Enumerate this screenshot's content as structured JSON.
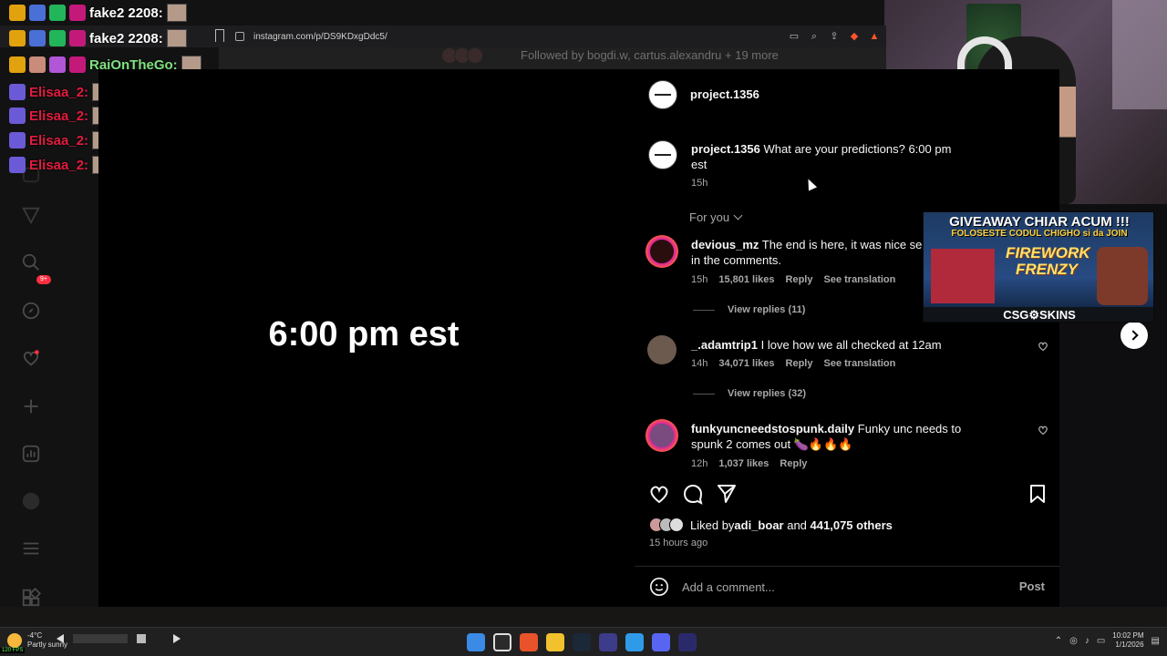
{
  "browser": {
    "url": "instagram.com/p/DS9KDxgDdc5/"
  },
  "chat_overlay": {
    "lines": [
      {
        "name": "fake2",
        "suffix": "2208:"
      },
      {
        "name": "fake2",
        "suffix": "2208:"
      },
      {
        "name": "RaiOnTheGo:"
      },
      {
        "name": "Elisaa_2:"
      },
      {
        "name": "Elisaa_2:"
      },
      {
        "name": "Elisaa_2:"
      },
      {
        "name": "Elisaa_2:"
      }
    ]
  },
  "top_strip": {
    "followed_by": "Followed by bogdi.w, cartus.alexandru + 19 more"
  },
  "sidebar": {
    "notifications_badge": "9+",
    "icons": [
      "instagram-icon",
      "home-icon",
      "reels-icon",
      "messages-icon",
      "search-icon",
      "explore-icon",
      "notifications-icon",
      "create-icon",
      "dashboard-icon",
      "profile-icon",
      "more-icon",
      "threads-icon"
    ]
  },
  "post": {
    "media_text": "6:00 pm est",
    "author": "project.1356",
    "caption_user": "project.1356",
    "caption_text": " What are your predictions? 6:00 pm est",
    "caption_time": "15h",
    "sort_label": "For you",
    "comments": [
      {
        "user": "devious_mz",
        "text": " The end is here, it was nice seeing you all in the comments.",
        "time": "15h",
        "likes": "15,801 likes",
        "reply": "Reply",
        "translation": "See translation",
        "replies": "View replies (11)"
      },
      {
        "user": "_.adamtrip1",
        "text": " I love how we all checked at 12am",
        "time": "14h",
        "likes": "34,071 likes",
        "reply": "Reply",
        "translation": "See translation",
        "replies": "View replies (32)"
      },
      {
        "user": "funkyuncneedstospunk.daily",
        "text": " Funky unc needs to spunk 2 comes out 🍆🔥🔥🔥",
        "time": "12h",
        "likes": "1,037 likes",
        "reply": "Reply"
      }
    ],
    "liked_by_prefix": "Liked by ",
    "liked_by_user": "adi_boar",
    "liked_by_and": " and ",
    "liked_by_count": "441,075 others",
    "posted_ago": "15 hours ago",
    "comment_placeholder": "Add a comment...",
    "post_button": "Post"
  },
  "ad": {
    "title": "GIVEAWAY CHIAR ACUM !!!",
    "subtitle": "FOLOSESTE CODUL CHIGHO si da JOIN",
    "game": "FIREWORK FRENZY",
    "brand": "CSG⚙SKINS"
  },
  "taskbar": {
    "temperature": "-4°C",
    "weather": "Partly sunny",
    "time": "10:02 PM",
    "date": "1/1/2026"
  },
  "fps": "120 FPS",
  "colors": {
    "background": "#000000",
    "text_primary": "#f5f5f5",
    "text_secondary": "#a8a8a8",
    "chat_red": "#e11c3f",
    "chat_green": "#7fe17f"
  }
}
